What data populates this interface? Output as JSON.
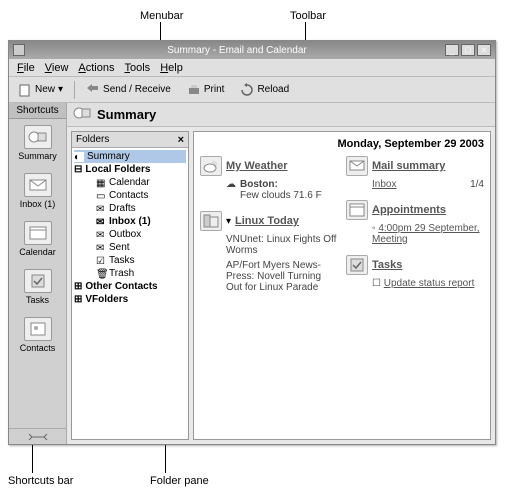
{
  "callouts": {
    "menubar": "Menubar",
    "toolbar": "Toolbar",
    "shortcuts_bar": "Shortcuts bar",
    "folder_pane": "Folder pane"
  },
  "window": {
    "title": "Summary - Email and Calendar"
  },
  "menubar": {
    "file": "File",
    "view": "View",
    "actions": "Actions",
    "tools": "Tools",
    "help": "Help"
  },
  "toolbar": {
    "new": "New",
    "send_receive": "Send / Receive",
    "print": "Print",
    "reload": "Reload"
  },
  "shortcuts": {
    "header": "Shortcuts",
    "items": [
      {
        "label": "Summary",
        "icon": "summary-icon"
      },
      {
        "label": "Inbox (1)",
        "icon": "inbox-icon"
      },
      {
        "label": "Calendar",
        "icon": "calendar-icon"
      },
      {
        "label": "Tasks",
        "icon": "tasks-icon"
      },
      {
        "label": "Contacts",
        "icon": "contacts-icon"
      }
    ]
  },
  "summary": {
    "title": "Summary",
    "date": "Monday, September 29 2003"
  },
  "folderpane": {
    "title": "Folders",
    "close": "×",
    "tree": {
      "summary": "Summary",
      "local": "Local Folders",
      "calendar": "Calendar",
      "contacts": "Contacts",
      "drafts": "Drafts",
      "inbox": "Inbox (1)",
      "outbox": "Outbox",
      "sent": "Sent",
      "tasks": "Tasks",
      "trash": "Trash",
      "other": "Other Contacts",
      "vfolders": "VFolders"
    }
  },
  "weather": {
    "title": "My Weather",
    "location": "Boston",
    "desc": "Few clouds 71.6 F"
  },
  "news": {
    "title": "Linux Today",
    "items": [
      "VNUnet: Linux Fights Off Worms",
      "AP/Fort Myers News-Press: Novell Turning Out for Linux Parade"
    ]
  },
  "mail": {
    "title": "Mail summary",
    "inbox_label": "Inbox",
    "inbox_count": "1/4"
  },
  "appointments": {
    "title": "Appointments",
    "item": "4:00pm 29 September, Meeting"
  },
  "tasks": {
    "title": "Tasks",
    "item": "Update status report"
  }
}
